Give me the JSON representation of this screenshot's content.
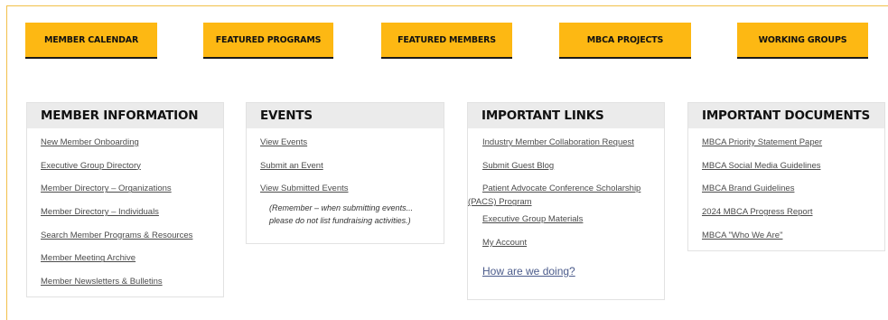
{
  "nav": {
    "buttons": [
      {
        "label": "MEMBER CALENDAR"
      },
      {
        "label": "FEATURED PROGRAMS"
      },
      {
        "label": "FEATURED MEMBERS"
      },
      {
        "label": "MBCA PROJECTS"
      },
      {
        "label": "WORKING GROUPS"
      }
    ]
  },
  "panels": {
    "member_info": {
      "title": "MEMBER INFORMATION",
      "links": [
        "New Member Onboarding",
        "Executive Group Directory",
        "Member Directory – Organizations",
        "Member Directory – Individuals",
        "Search Member Programs & Resources",
        "Member Meeting Archive",
        "Member Newsletters & Bulletins"
      ]
    },
    "events": {
      "title": "EVENTS",
      "links": [
        "View Events",
        "Submit an Event",
        "View Submitted Events"
      ],
      "note_line1": "(Remember – when submitting events...",
      "note_line2": "please do not list fundraising activities.)"
    },
    "important_links": {
      "title": "IMPORTANT LINKS",
      "links": [
        "Industry Member Collaboration Request",
        "Submit Guest Blog",
        "Patient Advocate Conference Scholarship (PACS) Program",
        "Executive Group Materials",
        "My Account"
      ],
      "feedback": "How are we doing?"
    },
    "important_docs": {
      "title": "IMPORTANT DOCUMENTS",
      "links": [
        "MBCA Priority Statement Paper",
        "MBCA Social Media Guidelines",
        "MBCA Brand Guidelines",
        "2024 MBCA Progress Report",
        "MBCA \"Who We Are\""
      ]
    }
  },
  "colors": {
    "accent": "#fdb813",
    "panel_header": "#ebebeb",
    "link": "#4b4b4b"
  }
}
